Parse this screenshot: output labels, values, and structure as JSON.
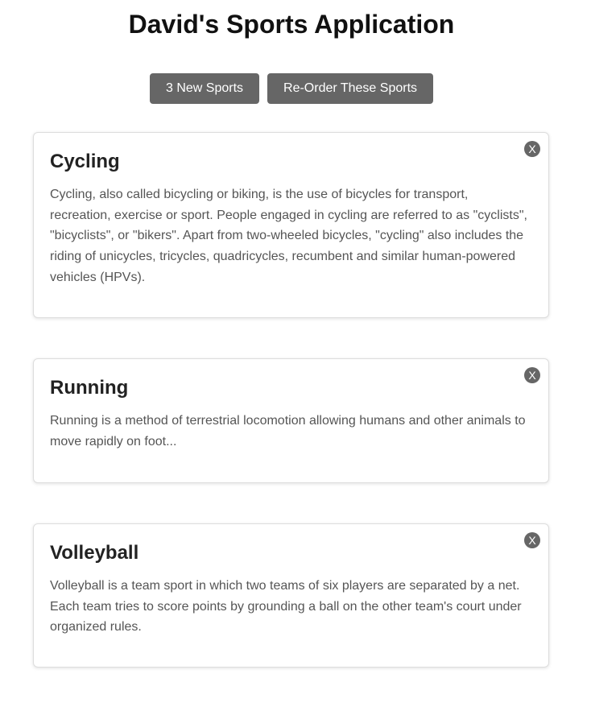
{
  "header": {
    "title": "David's Sports Application"
  },
  "toolbar": {
    "new_sports_label": "3 New Sports",
    "reorder_label": "Re-Order These Sports"
  },
  "cards": [
    {
      "title": "Cycling",
      "description": "Cycling, also called bicycling or biking, is the use of bicycles for transport, recreation, exercise or sport. People engaged in cycling are referred to as \"cyclists\", \"bicyclists\", or \"bikers\". Apart from two-wheeled bicycles, \"cycling\" also includes the riding of unicycles, tricycles, quadricycles, recumbent and similar human-powered vehicles (HPVs).",
      "close_label": "X"
    },
    {
      "title": "Running",
      "description": "Running is a method of terrestrial locomotion allowing humans and other animals to move rapidly on foot...",
      "close_label": "X"
    },
    {
      "title": "Volleyball",
      "description": "Volleyball is a team sport in which two teams of six players are separated by a net. Each team tries to score points by grounding a ball on the other team's court under organized rules.",
      "close_label": "X"
    }
  ]
}
